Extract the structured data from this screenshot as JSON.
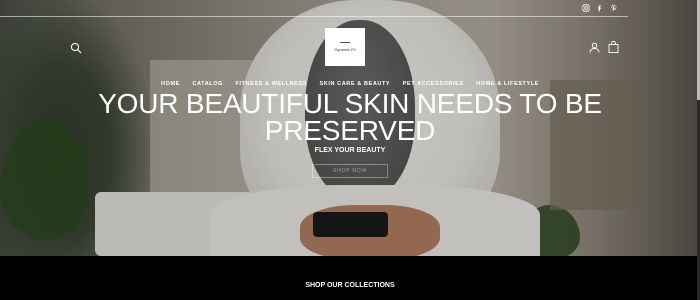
{
  "social": {
    "icons": [
      "instagram-icon",
      "facebook-icon",
      "pinterest-icon"
    ]
  },
  "logo": {
    "text": "Dynamic Fit"
  },
  "nav": {
    "items": [
      {
        "label": "HOME"
      },
      {
        "label": "CATALOG"
      },
      {
        "label": "FITNESS & WELLNESS"
      },
      {
        "label": "SKIN CARE & BEAUTY"
      },
      {
        "label": "PET ACCESSORIES"
      },
      {
        "label": "HOME & LIFESTYLE"
      }
    ]
  },
  "hero": {
    "headline_line1": "YOUR BEAUTIFUL SKIN NEEDS TO BE",
    "headline_line2": "PRESERVED",
    "subheading": "FLEX YOUR BEAUTY",
    "cta_label": "SHOP NOW"
  },
  "section": {
    "title": "SHOP OUR COLLECTIONS"
  },
  "colors": {
    "text": "#ffffff",
    "footer_bg": "#000000"
  }
}
